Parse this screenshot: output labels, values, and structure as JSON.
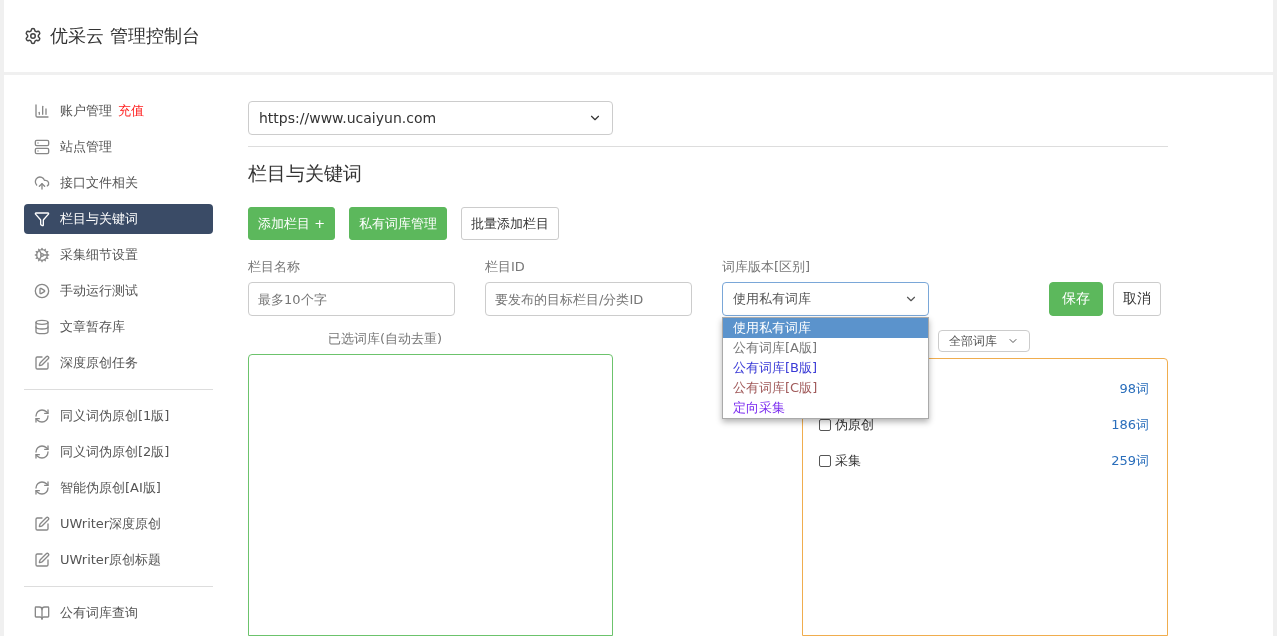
{
  "header": {
    "title": "优采云 管理控制台"
  },
  "sidebar": {
    "groups": [
      [
        {
          "label": "账户管理",
          "badge": "充值",
          "selected": false
        },
        {
          "label": "站点管理",
          "selected": false
        },
        {
          "label": "接口文件相关",
          "selected": false
        },
        {
          "label": "栏目与关键词",
          "selected": true
        },
        {
          "label": "采集细节设置",
          "selected": false
        },
        {
          "label": "手动运行测试",
          "selected": false
        },
        {
          "label": "文章暂存库",
          "selected": false
        },
        {
          "label": "深度原创任务",
          "selected": false
        }
      ],
      [
        {
          "label": "同义词伪原创[1版]",
          "selected": false
        },
        {
          "label": "同义词伪原创[2版]",
          "selected": false
        },
        {
          "label": "智能伪原创[AI版]",
          "selected": false
        },
        {
          "label": "UWriter深度原创",
          "selected": false
        },
        {
          "label": "UWriter原创标题",
          "selected": false
        }
      ],
      [
        {
          "label": "公有词库查询",
          "selected": false
        }
      ]
    ]
  },
  "site_select": {
    "value": "https://www.ucaiyun.com"
  },
  "section_title": "栏目与关键词",
  "actions": [
    {
      "kind": "primary",
      "label": "添加栏目 +"
    },
    {
      "kind": "primary",
      "label": "私有词库管理"
    },
    {
      "kind": "default",
      "label": "批量添加栏目"
    }
  ],
  "form": {
    "name_field": {
      "label": "栏目名称",
      "placeholder": "最多10个字"
    },
    "id_field": {
      "label": "栏目ID",
      "placeholder": "要发布的目标栏目/分类ID"
    },
    "version_select": {
      "label": "词库版本[区别]",
      "value": "使用私有词库",
      "expanded": true,
      "options": [
        {
          "label": "使用私有词库",
          "selected": true,
          "color": "#ffffff"
        },
        {
          "label": "公有词库[A版]",
          "selected": false,
          "color": "#777777"
        },
        {
          "label": "公有词库[B版]",
          "selected": false,
          "color": "#3a3ad6"
        },
        {
          "label": "公有词库[C版]",
          "selected": false,
          "color": "#a05a5a"
        },
        {
          "label": "定向采集",
          "selected": false,
          "color": "#7b2bf0"
        }
      ]
    },
    "save": "保存",
    "cancel": "取消"
  },
  "selected_label": "已选词库(自动去重)",
  "filter_select": {
    "value": "全部词库"
  },
  "libraries": [
    {
      "count": "98词"
    },
    {
      "name": "伪原创",
      "checked": false,
      "count": "186词"
    },
    {
      "name": "采集",
      "checked": false,
      "count": "259词"
    }
  ]
}
